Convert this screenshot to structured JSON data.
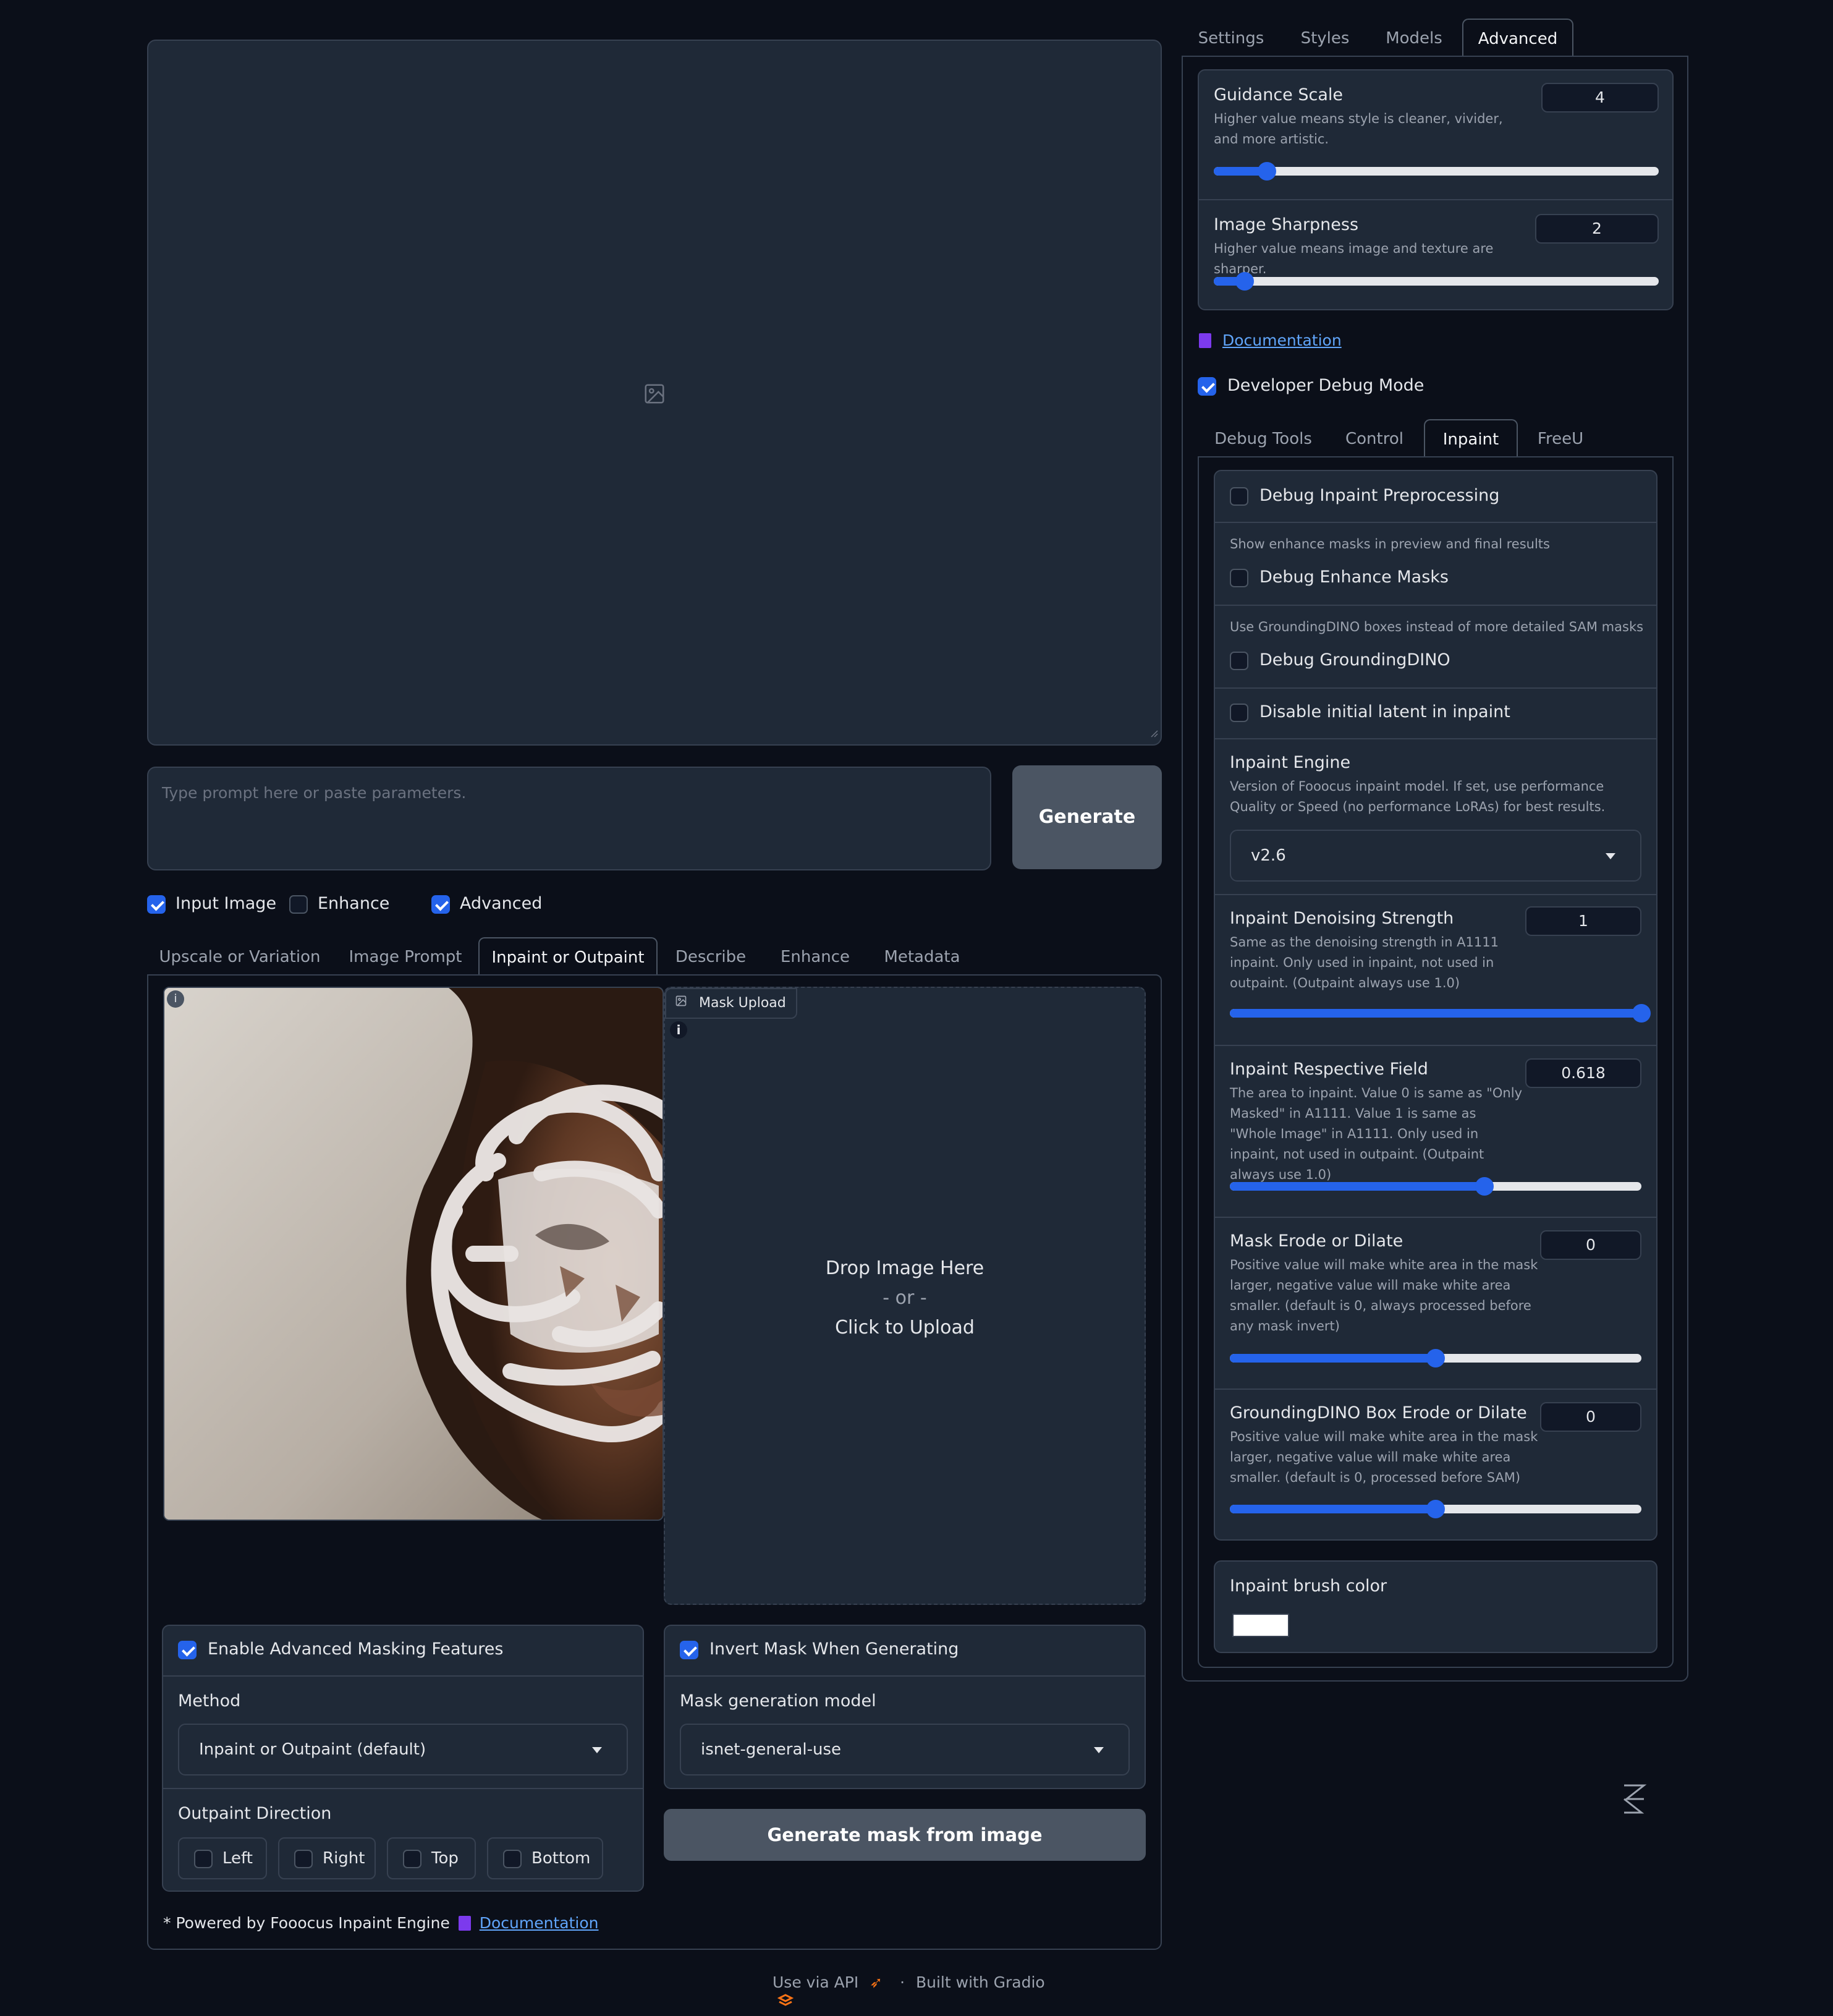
{
  "main": {
    "prompt_placeholder": "Type prompt here or paste parameters.",
    "generate_label": "Generate"
  },
  "options": {
    "input_image": {
      "label": "Input Image",
      "checked": true
    },
    "enhance": {
      "label": "Enhance",
      "checked": false
    },
    "advanced": {
      "label": "Advanced",
      "checked": true
    }
  },
  "input_tabs": [
    "Upscale or Variation",
    "Image Prompt",
    "Inpaint or Outpaint",
    "Describe",
    "Enhance",
    "Metadata"
  ],
  "input_tabs_active": "Inpaint or Outpaint",
  "mask_upload": {
    "title": "Mask Upload",
    "drop_text": "Drop Image Here",
    "or_text": "- or -",
    "click_text": "Click to Upload"
  },
  "masking": {
    "enable_advanced": "Enable Advanced Masking Features",
    "method_label": "Method",
    "method_value": "Inpaint or Outpaint (default)",
    "outpaint_direction_label": "Outpaint Direction",
    "directions": [
      "Left",
      "Right",
      "Top",
      "Bottom"
    ],
    "invert_mask": "Invert Mask When Generating",
    "mask_model_label": "Mask generation model",
    "mask_model_value": "isnet-general-use",
    "generate_mask_label": "Generate mask from image",
    "powered_by": "* Powered by Fooocus Inpaint Engine",
    "doc_label": "Documentation"
  },
  "right_tabs": [
    "Settings",
    "Styles",
    "Models",
    "Advanced"
  ],
  "right_tabs_active": "Advanced",
  "advanced": {
    "guidance_scale": {
      "label": "Guidance Scale",
      "info": "Higher value means style is cleaner, vivider, and more artistic.",
      "value": "4",
      "fraction": 0.12
    },
    "image_sharpness": {
      "label": "Image Sharpness",
      "info": "Higher value means image and texture are sharper.",
      "value": "2",
      "fraction": 0.07
    },
    "documentation": "Documentation",
    "developer_debug": {
      "label": "Developer Debug Mode",
      "checked": true
    }
  },
  "debug_tabs": [
    "Debug Tools",
    "Control",
    "Inpaint",
    "FreeU"
  ],
  "debug_tabs_active": "Inpaint",
  "inpaint": {
    "debug_preprocessing": "Debug Inpaint Preprocessing",
    "enhance_masks_info": "Show enhance masks in preview and final results",
    "debug_enhance_masks": "Debug Enhance Masks",
    "grounding_info": "Use GroundingDINO boxes instead of more detailed SAM masks",
    "debug_grounding": "Debug GroundingDINO",
    "disable_latent": "Disable initial latent in inpaint",
    "engine_label": "Inpaint Engine",
    "engine_info": "Version of Fooocus inpaint model. If set, use performance Quality or Speed (no performance LoRAs) for best results.",
    "engine_value": "v2.6",
    "denoising": {
      "label": "Inpaint Denoising Strength",
      "info": "Same as the denoising strength in A1111 inpaint. Only used in inpaint, not used in outpaint. (Outpaint always use 1.0)",
      "value": "1",
      "fraction": 1.0
    },
    "respective_field": {
      "label": "Inpaint Respective Field",
      "info": "The area to inpaint. Value 0 is same as \"Only Masked\" in A1111. Value 1 is same as \"Whole Image\" in A1111. Only used in inpaint, not used in outpaint. (Outpaint always use 1.0)",
      "value": "0.618",
      "fraction": 0.618
    },
    "erode_dilate": {
      "label": "Mask Erode or Dilate",
      "info": "Positive value will make white area in the mask larger, negative value will make white area smaller. (default is 0, always processed before any mask invert)",
      "value": "0",
      "fraction": 0.5
    },
    "grounding_erode": {
      "label": "GroundingDINO Box Erode or Dilate",
      "info": "Positive value will make white area in the mask larger, negative value will make white area smaller. (default is 0, processed before SAM)",
      "value": "0",
      "fraction": 0.5
    },
    "brush_color_label": "Inpaint brush color",
    "brush_color": "#ffffff"
  },
  "footer": {
    "use_api": "Use via API",
    "built_with": "Built with Gradio",
    "dot": "·"
  }
}
